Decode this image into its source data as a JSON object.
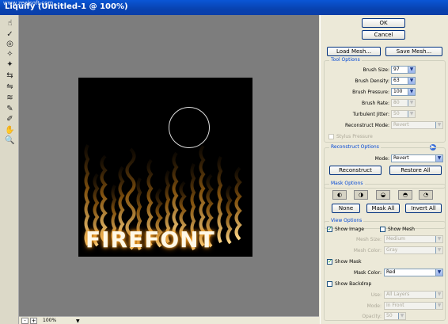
{
  "window": {
    "title": "Liquify (Untitled-1 @ 100%)",
    "watermark": "www.zealsoft.com"
  },
  "tools": [
    {
      "name": "forward-warp-tool",
      "glyph": "☝"
    },
    {
      "name": "reconstruct-tool",
      "glyph": "✓"
    },
    {
      "name": "twirl-tool",
      "glyph": "◎"
    },
    {
      "name": "pucker-tool",
      "glyph": "✧"
    },
    {
      "name": "bloat-tool",
      "glyph": "✦"
    },
    {
      "name": "push-left-tool",
      "glyph": "⇆"
    },
    {
      "name": "mirror-tool",
      "glyph": "⇋"
    },
    {
      "name": "turbulence-tool",
      "glyph": "≋"
    },
    {
      "name": "freeze-mask-tool",
      "glyph": "✎"
    },
    {
      "name": "thaw-mask-tool",
      "glyph": "✐"
    },
    {
      "name": "hand-tool",
      "glyph": "✋"
    },
    {
      "name": "zoom-tool",
      "glyph": "🔍"
    }
  ],
  "canvas": {
    "text": "FIREFONT"
  },
  "status": {
    "zoom": "100%",
    "minus": "-",
    "plus": "+"
  },
  "buttons": {
    "ok": "OK",
    "cancel": "Cancel",
    "load_mesh": "Load Mesh...",
    "save_mesh": "Save Mesh..."
  },
  "tool_options": {
    "legend": "Tool Options",
    "brush_size": {
      "label": "Brush Size:",
      "value": "97"
    },
    "brush_density": {
      "label": "Brush Density:",
      "value": "63"
    },
    "brush_pressure": {
      "label": "Brush Pressure:",
      "value": "100"
    },
    "brush_rate": {
      "label": "Brush Rate:",
      "value": "80"
    },
    "turbulent_jitter": {
      "label": "Turbulent Jitter:",
      "value": "50"
    },
    "reconstruct_mode": {
      "label": "Reconstruct Mode:",
      "value": "Revert"
    },
    "stylus_pressure": "Stylus Pressure"
  },
  "reconstruct_options": {
    "legend": "Reconstruct Options",
    "mode_label": "Mode:",
    "mode_value": "Revert",
    "reconstruct": "Reconstruct",
    "restore_all": "Restore All"
  },
  "mask_options": {
    "legend": "Mask Options",
    "none": "None",
    "mask_all": "Mask All",
    "invert_all": "Invert All"
  },
  "view_options": {
    "legend": "View Options",
    "show_image": "Show Image",
    "show_mesh": "Show Mesh",
    "mesh_size": {
      "label": "Mesh Size:",
      "value": "Medium"
    },
    "mesh_color": {
      "label": "Mesh Color:",
      "value": "Gray"
    },
    "show_mask": "Show Mask",
    "mask_color": {
      "label": "Mask Color:",
      "value": "Red"
    },
    "show_backdrop": "Show Backdrop",
    "use": {
      "label": "Use:",
      "value": "All Layers"
    },
    "mode": {
      "label": "Mode:",
      "value": "In Front"
    },
    "opacity": {
      "label": "Opacity:",
      "value": "50"
    }
  }
}
